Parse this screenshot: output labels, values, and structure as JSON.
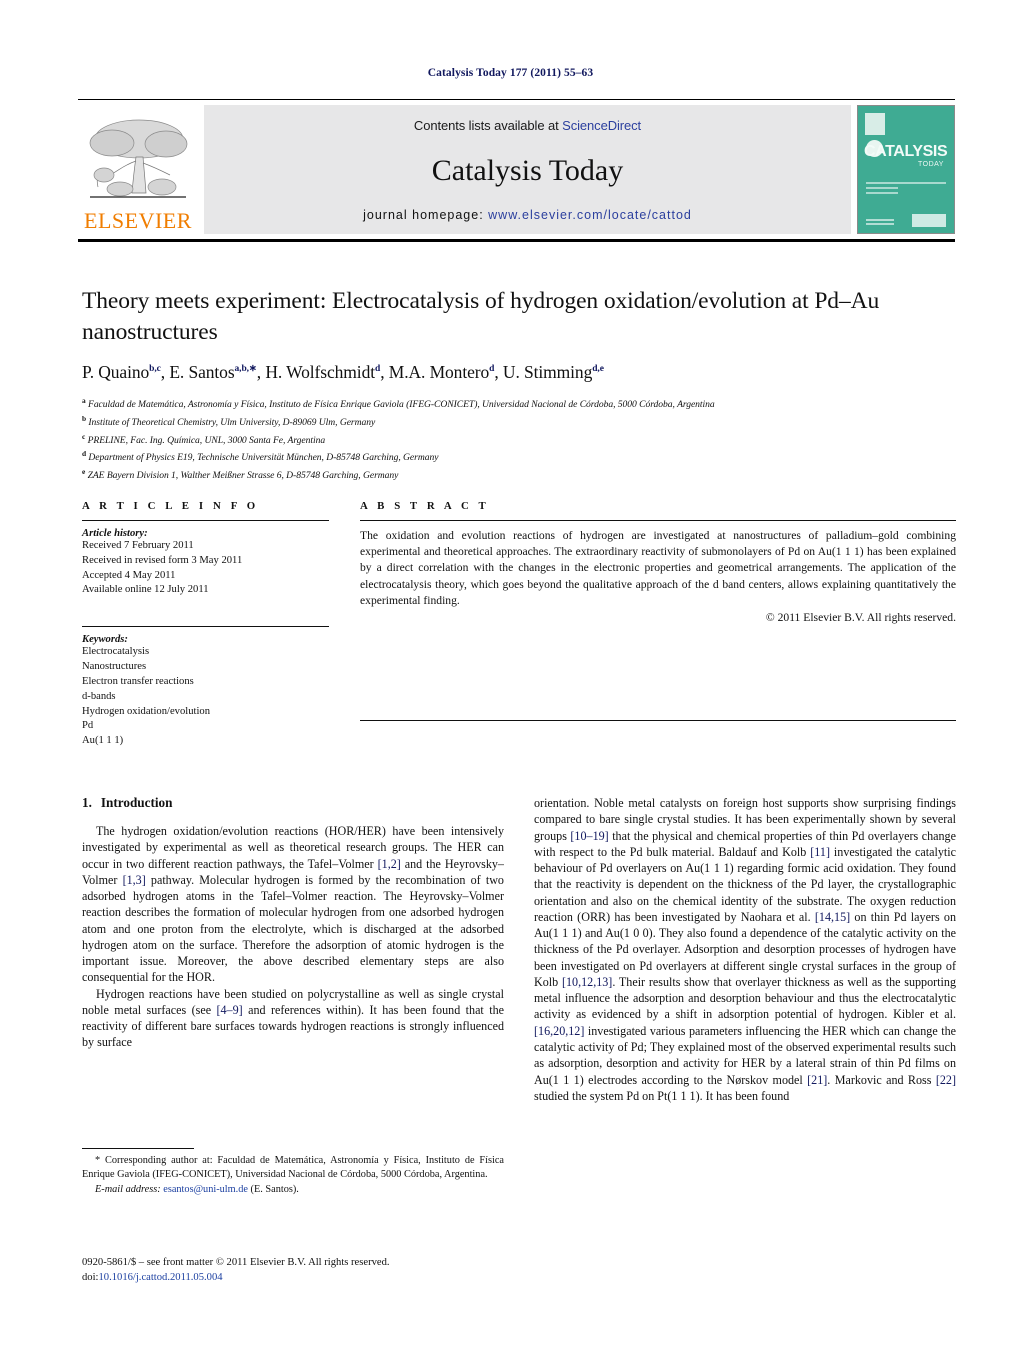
{
  "running_head": "Catalysis Today 177 (2011) 55–63",
  "masthead": {
    "contents_prefix": "Contents lists available at ",
    "sciencedirect": "ScienceDirect",
    "journal_name": "Catalysis Today",
    "homepage_prefix": "journal homepage:",
    "homepage_url": "www.elsevier.com/locate/cattod",
    "publisher": "ELSEVIER",
    "cover_title": "CATALYSIS",
    "cover_subtitle": "TODAY",
    "link_color": "#2b3f9e",
    "publisher_color": "#f07d00",
    "cover_color": "#3fab93"
  },
  "article": {
    "title": "Theory meets experiment: Electrocatalysis of hydrogen oxidation/evolution at Pd–Au nanostructures",
    "authors": [
      {
        "name": "P. Quaino",
        "sup": "b,c",
        "sep": ", "
      },
      {
        "name": "E. Santos",
        "sup": "a,b,∗",
        "sep": ", "
      },
      {
        "name": "H. Wolfschmidt",
        "sup": "d",
        "sep": ", "
      },
      {
        "name": "M.A. Montero",
        "sup": "d",
        "sep": ", "
      },
      {
        "name": "U. Stimming",
        "sup": "d,e",
        "sep": ""
      }
    ],
    "affiliations": [
      {
        "marker": "a",
        "text": "Faculdad de Matemática, Astronomía y Física, Instituto de Física Enrique Gaviola (IFEG-CONICET), Universidad Nacional de Córdoba, 5000 Córdoba, Argentina"
      },
      {
        "marker": "b",
        "text": "Institute of Theoretical Chemistry, Ulm University, D-89069 Ulm, Germany"
      },
      {
        "marker": "c",
        "text": "PRELINE, Fac. Ing. Química, UNL, 3000 Santa Fe, Argentina"
      },
      {
        "marker": "d",
        "text": "Department of Physics E19, Technische Universität München, D-85748 Garching, Germany"
      },
      {
        "marker": "e",
        "text": "ZAE Bayern Division 1, Walther Meißner Strasse 6, D-85748 Garching, Germany"
      }
    ]
  },
  "article_info": {
    "heading": "A R T I C L E   I N F O",
    "history_label": "Article history:",
    "history": [
      "Received 7 February 2011",
      "Received in revised form 3 May 2011",
      "Accepted 4 May 2011",
      "Available online 12 July 2011"
    ],
    "keywords_label": "Keywords:",
    "keywords": [
      "Electrocatalysis",
      "Nanostructures",
      "Electron transfer reactions",
      "d-bands",
      "Hydrogen oxidation/evolution",
      "Pd",
      "Au(1 1 1)"
    ]
  },
  "abstract": {
    "heading": "A B S T R A C T",
    "text": "The oxidation and evolution reactions of hydrogen are investigated at nanostructures of palladium–gold combining experimental and theoretical approaches. The extraordinary reactivity of submonolayers of Pd on Au(1 1 1) has been explained by a direct correlation with the changes in the electronic properties and geometrical arrangements. The application of the electrocatalysis theory, which goes beyond the qualitative approach of the d band centers, allows explaining quantitatively the experimental finding.",
    "copyright": "© 2011 Elsevier B.V. All rights reserved."
  },
  "body": {
    "section_number": "1.",
    "section_title": "Introduction",
    "left_paragraphs": [
      "The hydrogen oxidation/evolution reactions (HOR/HER) have been intensively investigated by experimental as well as theoretical research groups. The HER can occur in two different reaction pathways, the Tafel–Volmer [1,2] and the Heyrovsky–Volmer [1,3] pathway. Molecular hydrogen is formed by the recombination of two adsorbed hydrogen atoms in the Tafel–Volmer reaction. The Heyrovsky–Volmer reaction describes the formation of molecular hydrogen from one adsorbed hydrogen atom and one proton from the electrolyte, which is discharged at the adsorbed hydrogen atom on the surface. Therefore the adsorption of atomic hydrogen is the important issue. Moreover, the above described elementary steps are also consequential for the HOR.",
      "Hydrogen reactions have been studied on polycrystalline as well as single crystal noble metal surfaces (see [4–9] and references within). It has been found that the reactivity of different bare surfaces towards hydrogen reactions is strongly influenced by surface"
    ],
    "right_paragraphs": [
      "orientation. Noble metal catalysts on foreign host supports show surprising findings compared to bare single crystal studies. It has been experimentally shown by several groups [10–19] that the physical and chemical properties of thin Pd overlayers change with respect to the Pd bulk material. Baldauf and Kolb [11] investigated the catalytic behaviour of Pd overlayers on Au(1 1 1) regarding formic acid oxidation. They found that the reactivity is dependent on the thickness of the Pd layer, the crystallographic orientation and also on the chemical identity of the substrate. The oxygen reduction reaction (ORR) has been investigated by Naohara et al. [14,15] on thin Pd layers on Au(1 1 1) and Au(1 0 0). They also found a dependence of the catalytic activity on the thickness of the Pd overlayer. Adsorption and desorption processes of hydrogen have been investigated on Pd overlayers at different single crystal surfaces in the group of Kolb [10,12,13]. Their results show that overlayer thickness as well as the supporting metal influence the adsorption and desorption behaviour and thus the electrocatalytic activity as evidenced by a shift in adsorption potential of hydrogen. Kibler et al. [16,20,12] investigated various parameters influencing the HER which can change the catalytic activity of Pd; They explained most of the observed experimental results such as adsorption, desorption and activity for HER by a lateral strain of thin Pd films on Au(1 1 1) electrodes according to the Nørskov model [21]. Markovic and Ross [22] studied the system Pd on Pt(1 1 1). It has been found"
    ],
    "reference_color": "#11185e"
  },
  "footnotes": {
    "corresponding": "* Corresponding author at: Faculdad de Matemática, Astronomía y Física, Instituto de Física Enrique Gaviola (IFEG-CONICET), Universidad Nacional de Córdoba, 5000 Córdoba, Argentina.",
    "email_label": "E-mail address:",
    "email": "esantos@uni-ulm.de",
    "email_owner": "(E. Santos).",
    "issn_line": "0920-5861/$ – see front matter © 2011 Elsevier B.V. All rights reserved.",
    "doi_label": "doi:",
    "doi": "10.1016/j.cattod.2011.05.004"
  }
}
